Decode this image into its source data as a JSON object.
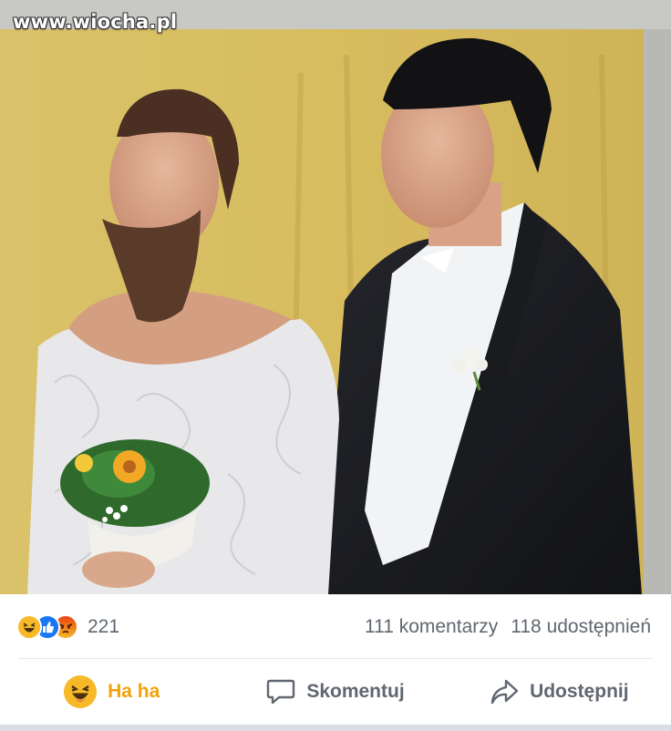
{
  "post": {
    "watermark": "www.wiocha.pl",
    "image_alt": "Bearded man in a white lace wedding dress holding a bouquet next to a man in a black tailcoat"
  },
  "reactions": {
    "icons": [
      "haha-icon",
      "like-icon",
      "angry-icon"
    ],
    "count": "221"
  },
  "stats": {
    "comments": "111 komentarzy",
    "shares": "118 udostępnień"
  },
  "actions": {
    "reaction_label": "Ha ha",
    "comment_label": "Skomentuj",
    "share_label": "Udostępnij"
  },
  "colors": {
    "haha": "#f7b928",
    "like": "#1877f2",
    "angry": "#e9710f",
    "text_secondary": "#606770"
  }
}
